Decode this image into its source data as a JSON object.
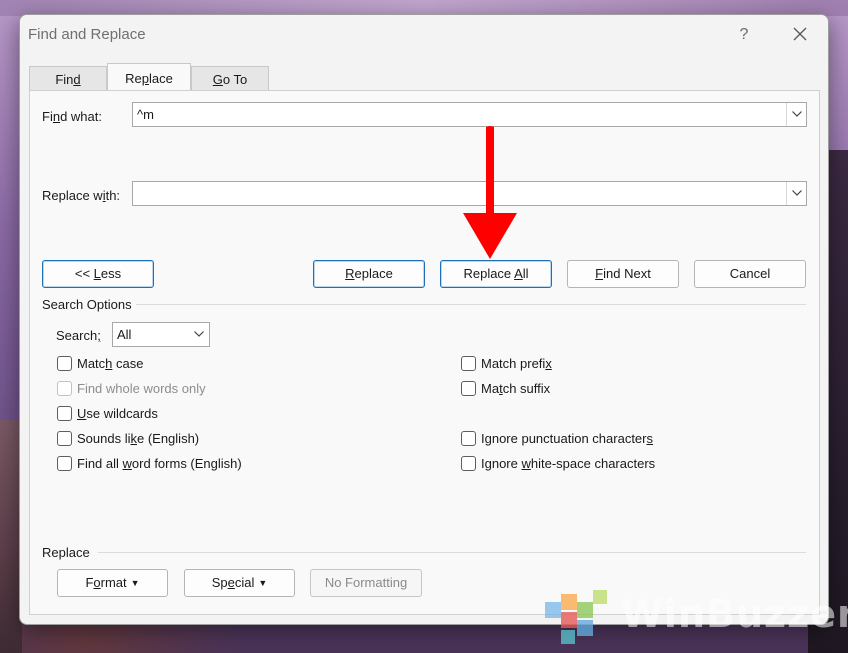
{
  "dialog": {
    "title": "Find and Replace",
    "help_label": "?",
    "tabs": [
      {
        "label_pre": "Fin",
        "label_u": "d",
        "label_post": ""
      },
      {
        "label_pre": "Re",
        "label_u": "p",
        "label_post": "lace"
      },
      {
        "label_pre": "",
        "label_u": "G",
        "label_post": "o To"
      }
    ],
    "active_tab": "Replace"
  },
  "find": {
    "label_pre": "Fi",
    "label_u": "n",
    "label_post": "d what:",
    "value": "^m"
  },
  "replace": {
    "label_pre": "Replace w",
    "label_u": "i",
    "label_post": "th:",
    "value": ""
  },
  "buttons": {
    "less": {
      "pre": "<< ",
      "u": "L",
      "post": "ess"
    },
    "replace": {
      "pre": "",
      "u": "R",
      "post": "eplace"
    },
    "replace_all": {
      "pre": "Replace ",
      "u": "A",
      "post": "ll"
    },
    "find_next": {
      "pre": "",
      "u": "F",
      "post": "ind Next"
    },
    "cancel": "Cancel"
  },
  "search_options": {
    "title": "Search Options",
    "search_label_pre": "Search",
    "search_label_u": ";",
    "search_label_post": "",
    "search_value": "All",
    "left": [
      {
        "pre": "Matc",
        "u": "h",
        "post": " case",
        "checked": false,
        "disabled": false
      },
      {
        "pre": "Find whole words only",
        "u": "",
        "post": "",
        "checked": false,
        "disabled": true
      },
      {
        "pre": "",
        "u": "U",
        "post": "se wildcards",
        "checked": false,
        "disabled": false
      },
      {
        "pre": "Sounds li",
        "u": "k",
        "post": "e (English)",
        "checked": false,
        "disabled": false
      },
      {
        "pre": "Find all ",
        "u": "w",
        "post": "ord forms (English)",
        "checked": false,
        "disabled": false
      }
    ],
    "right": [
      {
        "pre": "Match prefi",
        "u": "x",
        "post": "",
        "checked": false,
        "disabled": false
      },
      {
        "pre": "Ma",
        "u": "t",
        "post": "ch suffix",
        "checked": false,
        "disabled": false
      },
      {
        "pre": "Ignore punctuation character",
        "u": "s",
        "post": "",
        "checked": false,
        "disabled": false
      },
      {
        "pre": "Ignore ",
        "u": "w",
        "post": "hite-space characters",
        "checked": false,
        "disabled": false
      }
    ]
  },
  "replace_group": {
    "title": "Replace",
    "format": {
      "pre": "F",
      "u": "o",
      "post": "rmat"
    },
    "special": {
      "pre": "Sp",
      "u": "e",
      "post": "cial"
    },
    "no_formatting": "No Formatting"
  },
  "watermark": "WinBuzzer",
  "colors": {
    "annotation_arrow": "#ff0000",
    "button_focus_border": "#1e6fb5"
  }
}
